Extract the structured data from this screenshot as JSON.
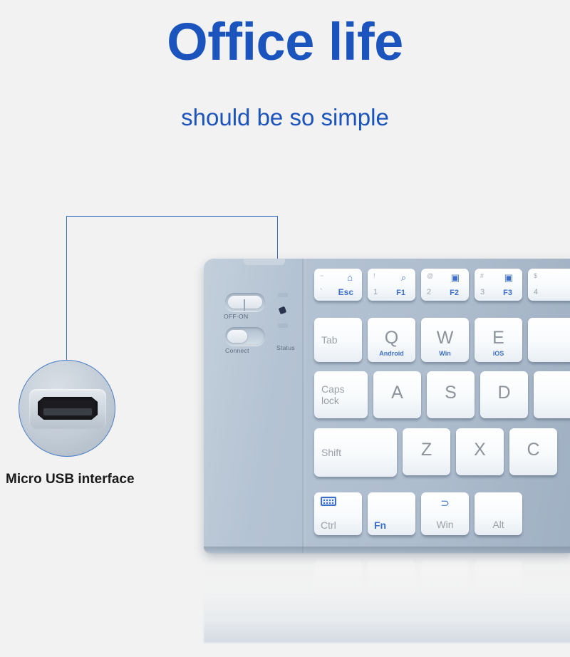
{
  "headline": "Office life",
  "subheadline": "should be so simple",
  "callout": {
    "caption": "Micro USB interface",
    "icon": "micro-usb-port-icon",
    "line_color": "#3a6fc4"
  },
  "colors": {
    "background": "#f2f2f2",
    "heading_blue": "#1a54bc",
    "keyboard_body": "#b4c3d3",
    "key_face": "#ffffff",
    "key_legend": "#8d939b",
    "accent_blue": "#3d6fc8"
  },
  "keyboard": {
    "controls": {
      "power_switch_label": "OFF·ON",
      "connect_button_label": "Connect",
      "status_label": "Status",
      "leds": [
        "led-top",
        "led-active",
        "led-bottom"
      ]
    },
    "rows": {
      "function_row": [
        {
          "name": "esc",
          "corner_top": "~",
          "corner_bottom": "`",
          "icon": "home-icon",
          "label": "Esc"
        },
        {
          "name": "f1",
          "corner_top": "!",
          "corner_bottom": "1",
          "icon": "search-icon",
          "label": "F1"
        },
        {
          "name": "f2",
          "corner_top": "@",
          "corner_bottom": "2",
          "icon": "app-icon",
          "label": "F2"
        },
        {
          "name": "f3",
          "corner_top": "#",
          "corner_bottom": "3",
          "icon": "app-icon",
          "label": "F3"
        },
        {
          "name": "f4",
          "corner_top": "$",
          "corner_bottom": "4",
          "icon": "",
          "label": ""
        }
      ],
      "qwerty_row": [
        {
          "name": "tab",
          "label": "Tab",
          "sub": ""
        },
        {
          "name": "q",
          "label": "Q",
          "sub": "Android"
        },
        {
          "name": "w",
          "label": "W",
          "sub": "Win"
        },
        {
          "name": "e",
          "label": "E",
          "sub": "iOS"
        },
        {
          "name": "r",
          "label": "",
          "sub": ""
        }
      ],
      "home_row": [
        {
          "name": "caps-lock",
          "label_line1": "Caps",
          "label_line2": "lock"
        },
        {
          "name": "a",
          "label": "A"
        },
        {
          "name": "s",
          "label": "S"
        },
        {
          "name": "d",
          "label": "D"
        },
        {
          "name": "f",
          "label": ""
        }
      ],
      "shift_row": [
        {
          "name": "shift",
          "label": "Shift"
        },
        {
          "name": "z",
          "label": "Z"
        },
        {
          "name": "x",
          "label": "X"
        },
        {
          "name": "c",
          "label": "C"
        }
      ],
      "modifier_row": [
        {
          "name": "ctrl",
          "label": "Ctrl",
          "icon": "keyboard-icon"
        },
        {
          "name": "fn",
          "label": "Fn",
          "icon": ""
        },
        {
          "name": "win",
          "label": "Win",
          "icon": "back-arrow-icon"
        },
        {
          "name": "alt",
          "label": "Alt",
          "icon": ""
        }
      ]
    }
  }
}
